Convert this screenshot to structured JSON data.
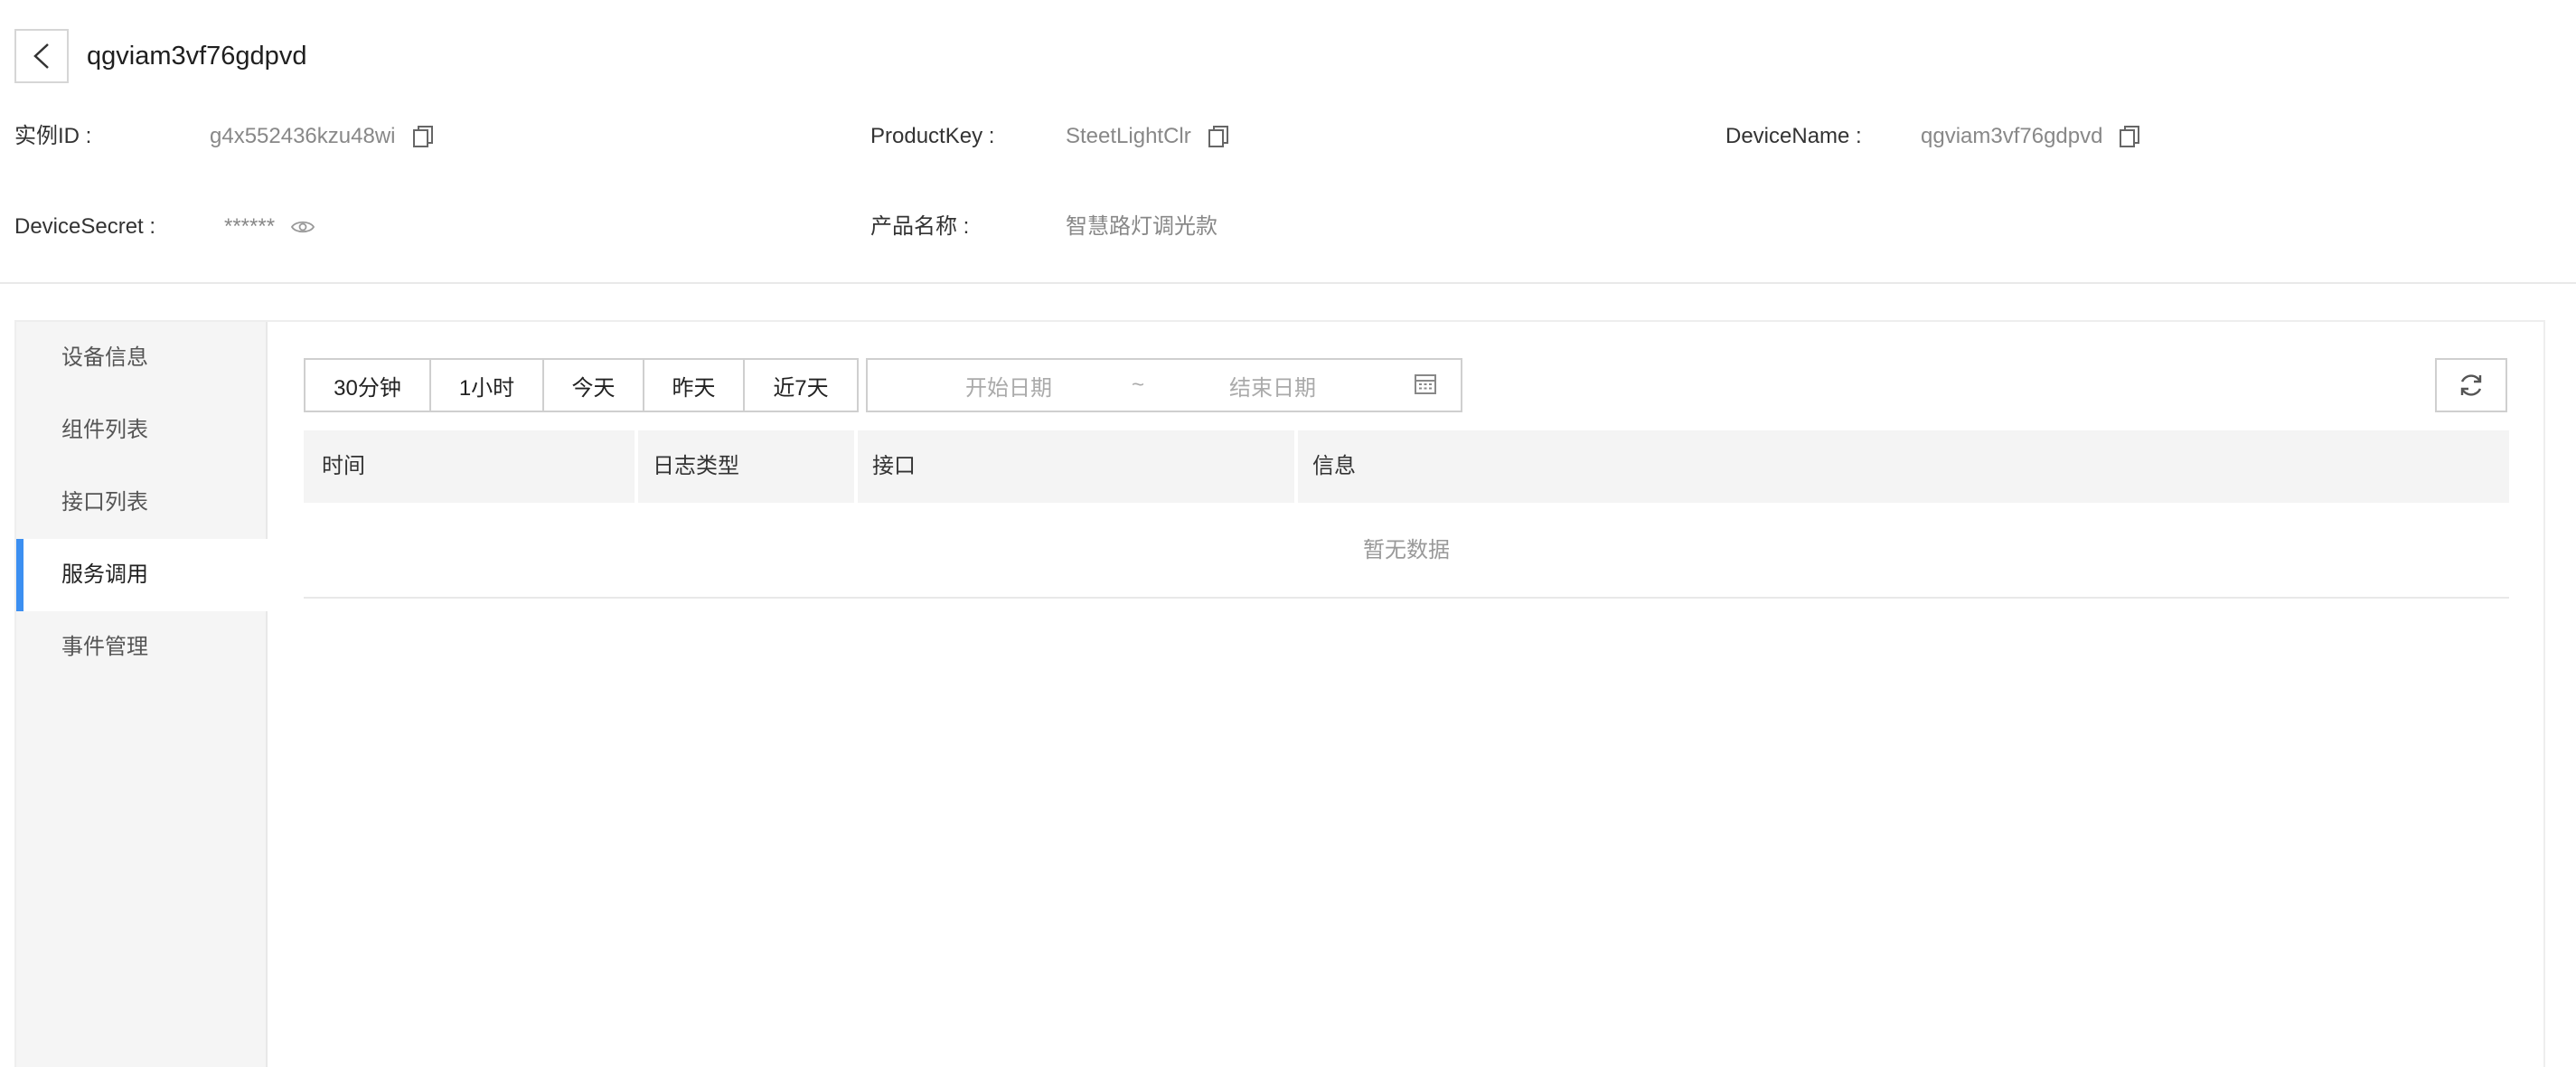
{
  "header": {
    "title": "qgviam3vf76gdpvd"
  },
  "info": {
    "instance_id_label": "实例ID :",
    "instance_id_value": "g4x552436kzu48wi",
    "product_key_label": "ProductKey :",
    "product_key_value": "SteetLightClr",
    "device_name_label": "DeviceName :",
    "device_name_value": "qgviam3vf76gdpvd",
    "device_secret_label": "DeviceSecret :",
    "device_secret_value": "******",
    "product_name_label": "产品名称 :",
    "product_name_value": "智慧路灯调光款"
  },
  "sidebar": {
    "items": [
      {
        "label": "设备信息"
      },
      {
        "label": "组件列表"
      },
      {
        "label": "接口列表"
      },
      {
        "label": "服务调用",
        "active": true
      },
      {
        "label": "事件管理"
      }
    ]
  },
  "filters": {
    "ranges": [
      "30分钟",
      "1小时",
      "今天",
      "昨天",
      "近7天"
    ],
    "start_placeholder": "开始日期",
    "separator": "~",
    "end_placeholder": "结束日期"
  },
  "table": {
    "columns": [
      "时间",
      "日志类型",
      "接口",
      "信息"
    ],
    "empty_text": "暂无数据"
  },
  "colors": {
    "accent": "#3c8ff1",
    "sidebar_bg": "#f5f5f5",
    "header_bg": "#f4f4f4"
  },
  "icons": {
    "back": "chevron-left-icon",
    "copy": "copy-icon",
    "reveal": "eye-icon",
    "calendar": "calendar-icon",
    "refresh": "refresh-icon"
  }
}
